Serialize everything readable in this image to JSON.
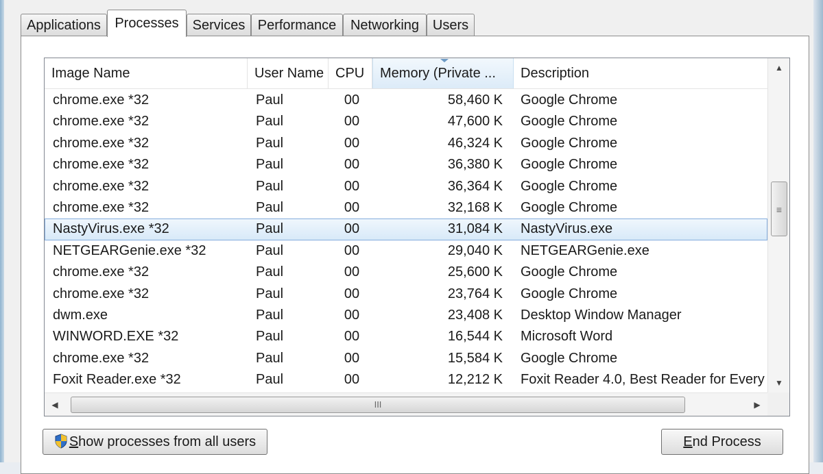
{
  "tabs": [
    {
      "label": "Applications",
      "active": false
    },
    {
      "label": "Processes",
      "active": true
    },
    {
      "label": "Services",
      "active": false
    },
    {
      "label": "Performance",
      "active": false
    },
    {
      "label": "Networking",
      "active": false
    },
    {
      "label": "Users",
      "active": false
    }
  ],
  "columns": {
    "image_name": "Image Name",
    "user_name": "User Name",
    "cpu": "CPU",
    "memory": "Memory (Private ...",
    "description": "Description"
  },
  "rows": [
    {
      "name": "chrome.exe *32",
      "user": "Paul",
      "cpu": "00",
      "memory": "58,460 K",
      "description": "Google Chrome"
    },
    {
      "name": "chrome.exe *32",
      "user": "Paul",
      "cpu": "00",
      "memory": "47,600 K",
      "description": "Google Chrome"
    },
    {
      "name": "chrome.exe *32",
      "user": "Paul",
      "cpu": "00",
      "memory": "46,324 K",
      "description": "Google Chrome"
    },
    {
      "name": "chrome.exe *32",
      "user": "Paul",
      "cpu": "00",
      "memory": "36,380 K",
      "description": "Google Chrome"
    },
    {
      "name": "chrome.exe *32",
      "user": "Paul",
      "cpu": "00",
      "memory": "36,364 K",
      "description": "Google Chrome"
    },
    {
      "name": "chrome.exe *32",
      "user": "Paul",
      "cpu": "00",
      "memory": "32,168 K",
      "description": "Google Chrome"
    },
    {
      "name": "NastyVirus.exe *32",
      "user": "Paul",
      "cpu": "00",
      "memory": "31,084 K",
      "description": "NastyVirus.exe",
      "selected": true
    },
    {
      "name": "NETGEARGenie.exe *32",
      "user": "Paul",
      "cpu": "00",
      "memory": "29,040 K",
      "description": "NETGEARGenie.exe"
    },
    {
      "name": "chrome.exe *32",
      "user": "Paul",
      "cpu": "00",
      "memory": "25,600 K",
      "description": "Google Chrome"
    },
    {
      "name": "chrome.exe *32",
      "user": "Paul",
      "cpu": "00",
      "memory": "23,764 K",
      "description": "Google Chrome"
    },
    {
      "name": "dwm.exe",
      "user": "Paul",
      "cpu": "00",
      "memory": "23,408 K",
      "description": "Desktop Window Manager"
    },
    {
      "name": "WINWORD.EXE *32",
      "user": "Paul",
      "cpu": "00",
      "memory": "16,544 K",
      "description": "Microsoft Word"
    },
    {
      "name": "chrome.exe *32",
      "user": "Paul",
      "cpu": "00",
      "memory": "15,584 K",
      "description": "Google Chrome"
    },
    {
      "name": "Foxit Reader.exe *32",
      "user": "Paul",
      "cpu": "00",
      "memory": "12,212 K",
      "description": "Foxit Reader 4.0, Best Reader for Every"
    }
  ],
  "buttons": {
    "show_all_first": "S",
    "show_all_rest": "how processes from all users",
    "end_first": "E",
    "end_rest": "nd Process"
  },
  "icons": {
    "shield": "uac-shield-icon",
    "sorted_column": "memory"
  },
  "colors": {
    "selection": "#d7e9f8",
    "selection_border": "#84acdd"
  }
}
